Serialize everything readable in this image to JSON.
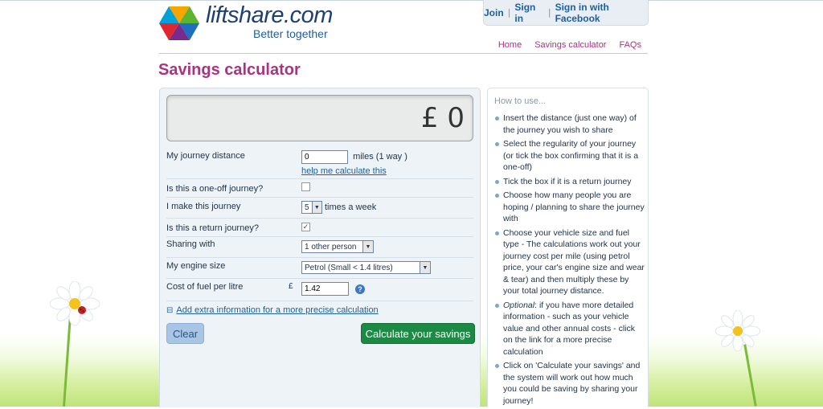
{
  "brand": {
    "name": "liftshare.com",
    "tagline": "Better together"
  },
  "auth": {
    "join": "Join",
    "signin": "Sign in",
    "facebook": "Sign in with Facebook",
    "sep": "|"
  },
  "nav": [
    "Home",
    "Savings calculator",
    "FAQs"
  ],
  "page": {
    "title": "Savings calculator"
  },
  "calculator": {
    "display": "£ 0",
    "distance": {
      "label": "My journey distance",
      "value": "0",
      "unit": "miles (1 way )",
      "help_link": "help me calculate this"
    },
    "one_off": {
      "label": "Is this a one-off journey?",
      "checked": false
    },
    "frequency": {
      "label": "I make this journey",
      "value": "5",
      "suffix": "times a week"
    },
    "return": {
      "label": "Is this a return journey?",
      "checked": true,
      "mark": "✓"
    },
    "sharing": {
      "label": "Sharing with",
      "value": "1 other person"
    },
    "engine": {
      "label": "My engine size",
      "value": "Petrol (Small < 1.4 litres)"
    },
    "fuel": {
      "label": "Cost of fuel per litre",
      "currency": "£",
      "value": "1.42",
      "help": "?"
    },
    "extra": {
      "toggle": "⊟",
      "link": "Add extra information for a more precise calculation"
    },
    "clear_label": "Clear",
    "calculate_label": "Calculate your savings"
  },
  "howto": {
    "title": "How to use...",
    "items": [
      "Insert the distance (just one way) of the journey you wish to share",
      "Select the regularity of your journey (or tick the box confirming that it is a one-off)",
      "Tick the box if it is a return journey",
      "Choose how many people you are hoping / planning to share the journey with",
      "Choose your vehicle size and fuel type - The calculations work out your journey cost per mile (using petrol price, your car's engine size and wear & tear) and then multiply these by your total journey distance.",
      "Click on 'Calculate your savings' and the system will work out how much you could be saving by sharing your journey!"
    ],
    "optional_label": "Optional",
    "optional_text": ": if you have more detailed information - such as your vehicle value and other annual costs - click on the link for a more precise calculation"
  },
  "colors": {
    "accent": "#a8347f",
    "brand": "#1e3f73",
    "link": "#1e5fa0",
    "calc_button": "#1c8a45",
    "clear_button": "#a9c5e6"
  },
  "icons": {
    "logo": "hexagon-triangles-logo",
    "help": "question-icon",
    "collapse": "minus-box-icon",
    "dropdown": "chevron-down-icon"
  }
}
